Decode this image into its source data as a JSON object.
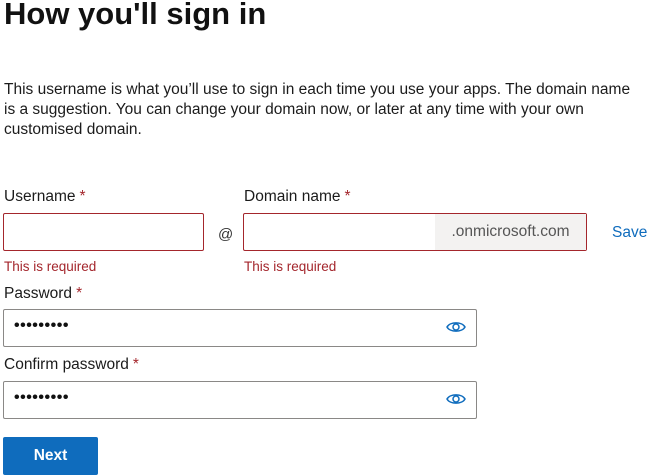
{
  "page": {
    "title": "How you'll sign in",
    "description": "This username is what you’ll use to sign in each time you use your apps. The domain name is a suggestion. You can change your domain now, or later at any time with your own customised domain."
  },
  "username": {
    "label": "Username",
    "required_mark": "*",
    "value": "",
    "error": "This is required"
  },
  "at_symbol": "@",
  "domain": {
    "label": "Domain name",
    "required_mark": "*",
    "value": "",
    "suffix": ".onmicrosoft.com",
    "error": "This is required",
    "save_label": "Save"
  },
  "password": {
    "label": "Password",
    "required_mark": "*",
    "masked_value": "•••••••••",
    "icon": "eye-icon"
  },
  "confirm_password": {
    "label": "Confirm password",
    "required_mark": "*",
    "masked_value": "•••••••••",
    "icon": "eye-icon"
  },
  "actions": {
    "next_label": "Next"
  },
  "colors": {
    "accent": "#0f6cbd",
    "error": "#a4262c",
    "suffix_bg": "#f3f2f1"
  }
}
